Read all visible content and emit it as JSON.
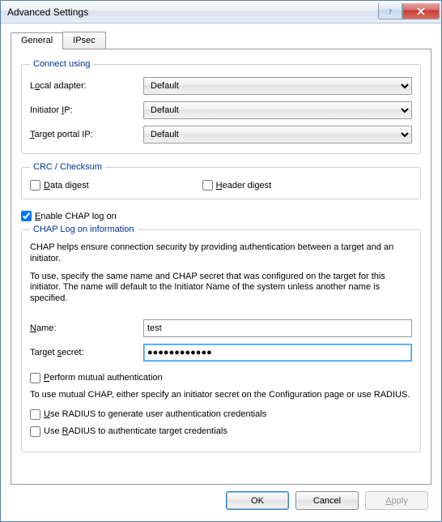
{
  "window": {
    "title": "Advanced Settings"
  },
  "tabs": {
    "general": "General",
    "ipsec": "IPsec"
  },
  "connect": {
    "legend": "Connect using",
    "local_adapter_label_pre": "L",
    "local_adapter_label_u": "o",
    "local_adapter_label_post": "cal adapter:",
    "local_adapter_value": "Default",
    "initiator_ip_label_pre": "Initiator ",
    "initiator_ip_label_u": "I",
    "initiator_ip_label_post": "P:",
    "initiator_ip_value": "Default",
    "target_ip_label_pre": "",
    "target_ip_label_u": "T",
    "target_ip_label_post": "arget portal IP:",
    "target_ip_value": "Default"
  },
  "crc": {
    "legend": "CRC / Checksum",
    "data_u": "D",
    "data_post": "ata digest",
    "header_u": "H",
    "header_post": "eader digest"
  },
  "chap": {
    "enable_u": "E",
    "enable_post": "nable CHAP log on",
    "enable_checked": true,
    "legend": "CHAP Log on information",
    "info1": "CHAP helps ensure connection security by providing authentication between a target and an initiator.",
    "info2": "To use, specify the same name and CHAP secret that was configured on the target for this initiator.  The name will default to the Initiator Name of the system unless another name is specified.",
    "name_u": "N",
    "name_post": "ame:",
    "name_value": "test",
    "secret_pre": "Target ",
    "secret_u": "s",
    "secret_post": "ecret:",
    "secret_value": "●●●●●●●●●●●●",
    "mutual_u": "P",
    "mutual_post": "erform mutual authentication",
    "mutual_info": "To use mutual CHAP, either specify an initiator secret on the Configuration page or use RADIUS.",
    "radius1_pre": "",
    "radius1_u": "U",
    "radius1_post": "se RADIUS to generate user authentication credentials",
    "radius2_pre": "Use ",
    "radius2_u": "R",
    "radius2_post": "ADIUS to authenticate target credentials"
  },
  "buttons": {
    "ok": "OK",
    "cancel": "Cancel",
    "apply_u": "A",
    "apply_post": "pply"
  }
}
